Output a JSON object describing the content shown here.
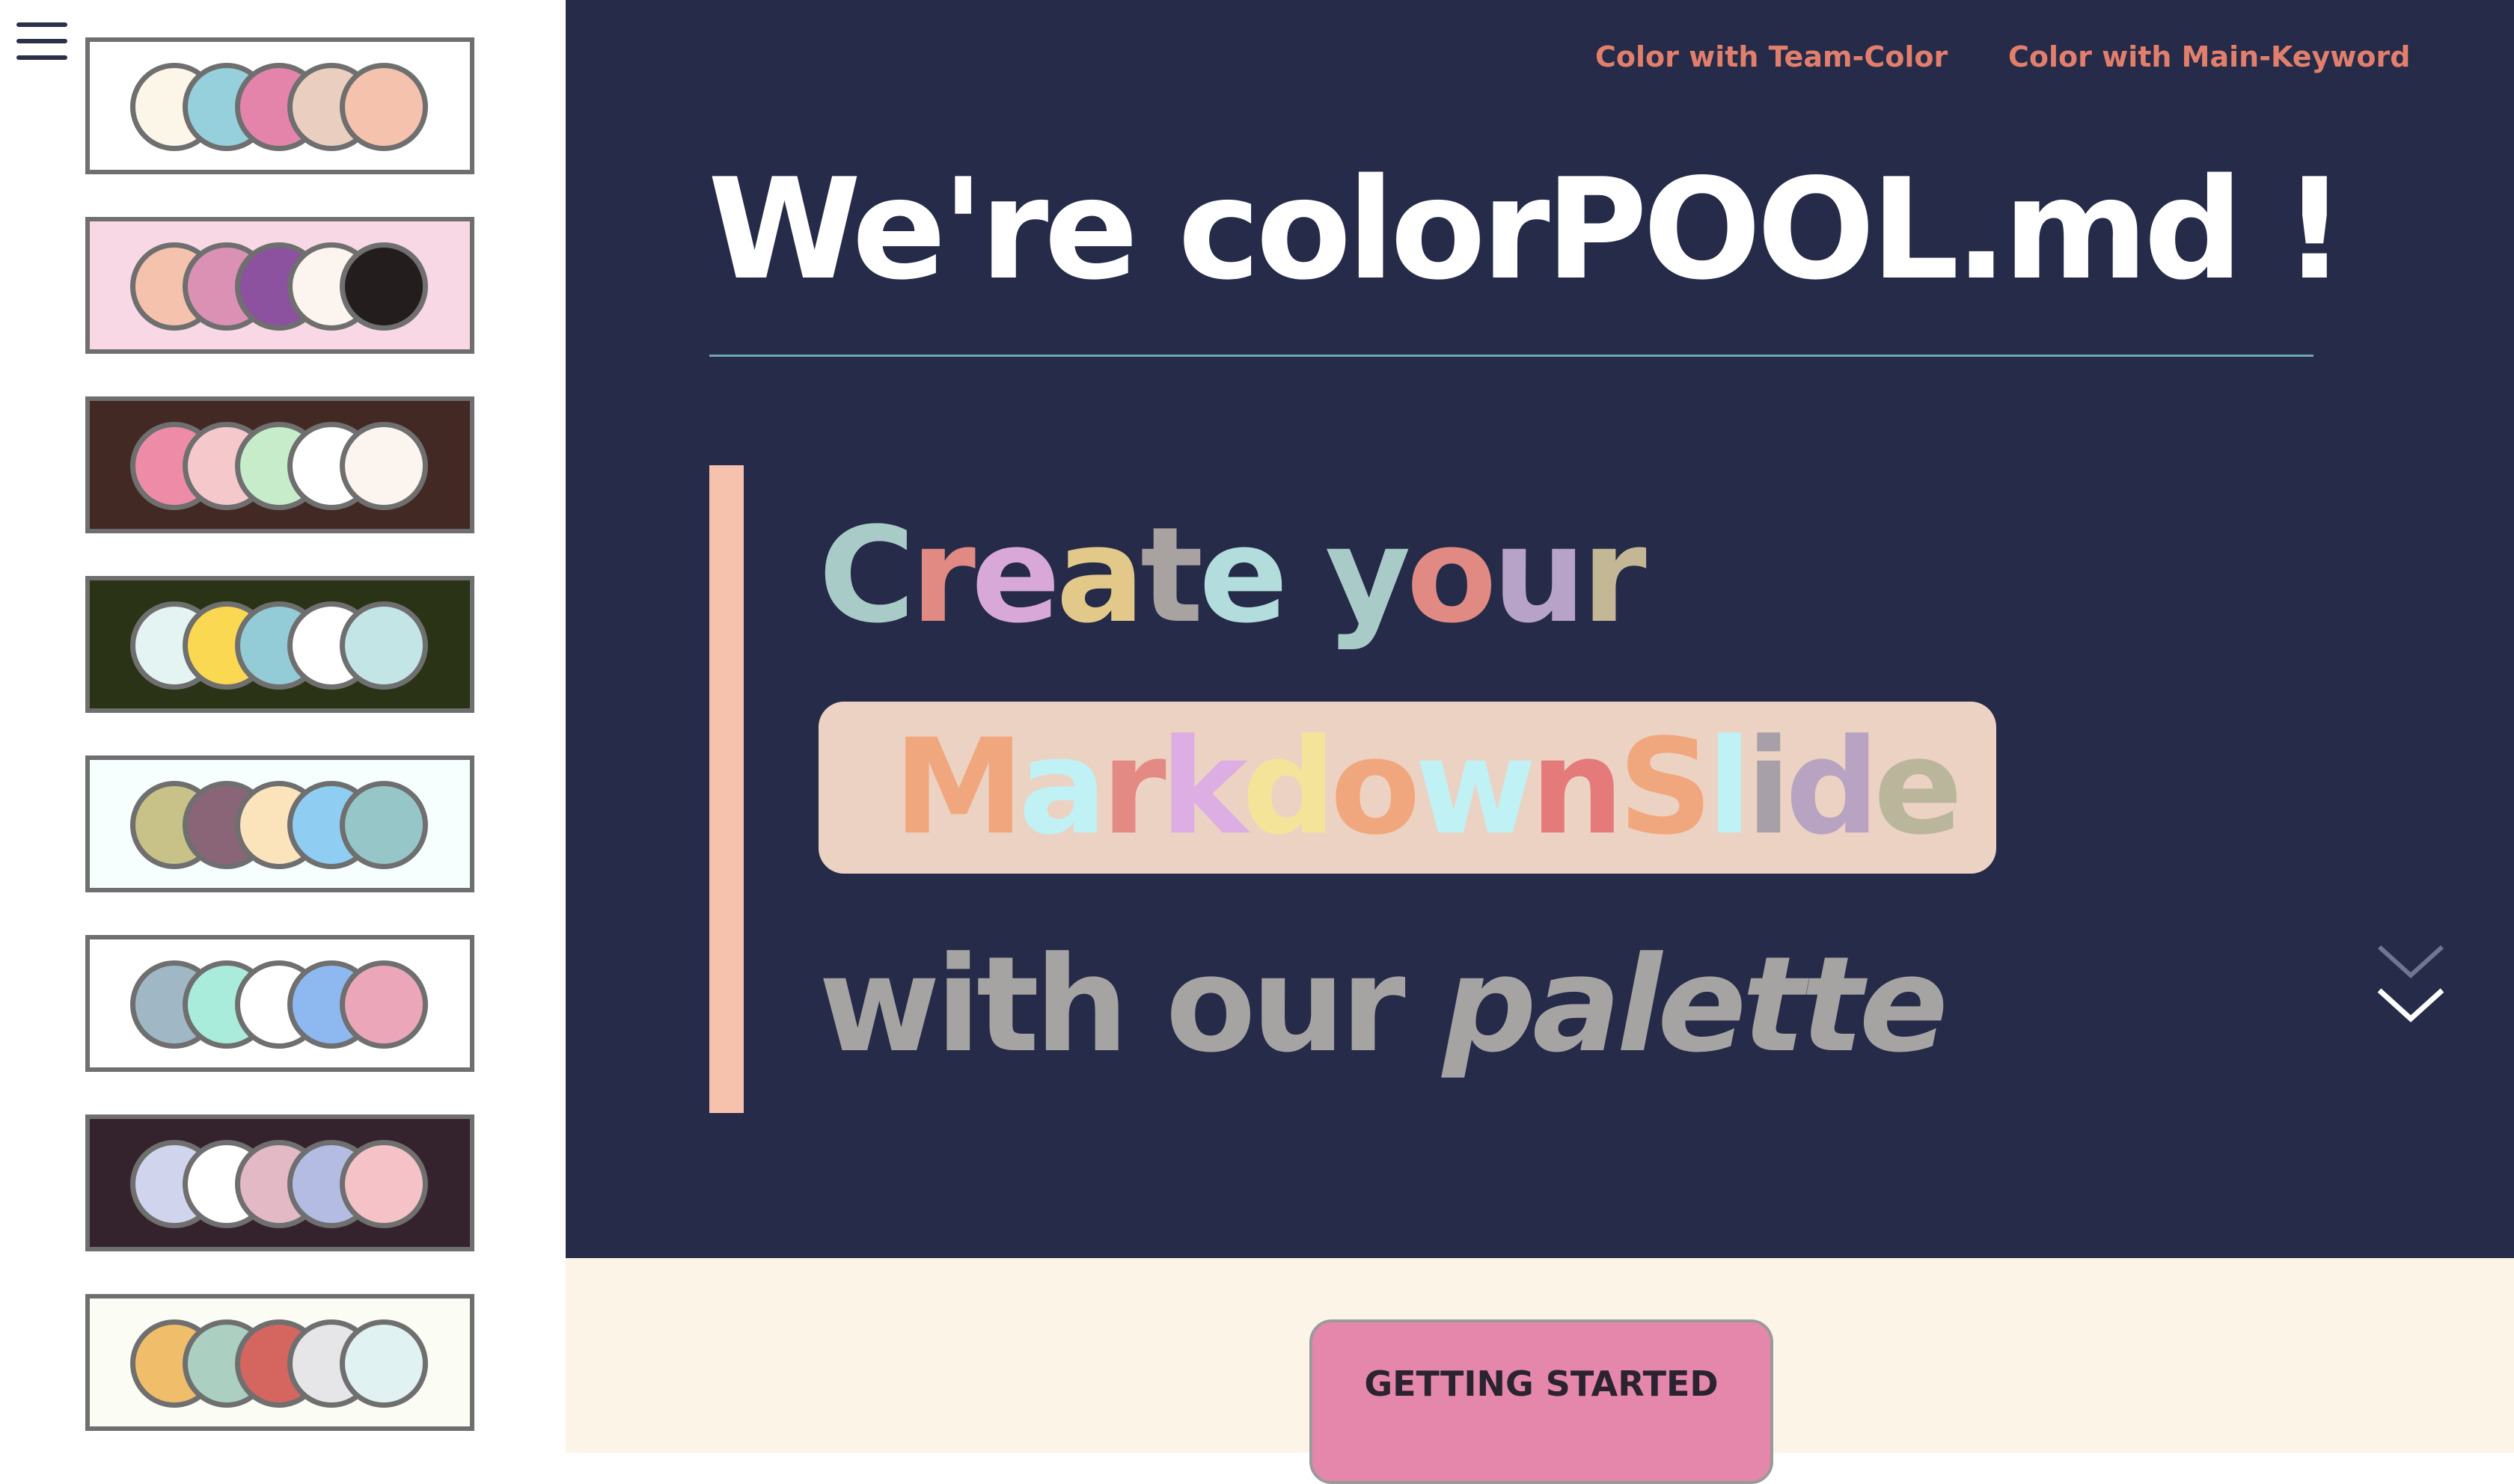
{
  "sidebar": {
    "menu_icon": "hamburger-menu-icon",
    "palettes": [
      {
        "background": "#ffffff",
        "swatches": [
          "#fcf6e8",
          "#95d0dc",
          "#e584ab",
          "#eacfc0",
          "#f5c2ad"
        ]
      },
      {
        "background": "#f7d8e4",
        "swatches": [
          "#f5c2ad",
          "#da91b3",
          "#8c519f",
          "#fcf4ee",
          "#231d1d"
        ]
      },
      {
        "background": "#422924",
        "swatches": [
          "#ee8ca8",
          "#f5c8cc",
          "#c6ecca",
          "#ffffff",
          "#fcf4ee"
        ]
      },
      {
        "background": "#2a3316",
        "swatches": [
          "#e4f4f3",
          "#fbd851",
          "#93cbd6",
          "#ffffff",
          "#c3e5e6"
        ]
      },
      {
        "background": "#f6fefe",
        "swatches": [
          "#c8c288",
          "#8a6578",
          "#fbe4bc",
          "#8fcdf2",
          "#97c6c9"
        ]
      },
      {
        "background": "#ffffff",
        "swatches": [
          "#a0b8c6",
          "#a9ecdc",
          "#ffffff",
          "#8db9f0",
          "#eba6b9"
        ]
      },
      {
        "background": "#34232c",
        "swatches": [
          "#d0d4ed",
          "#ffffff",
          "#e2b9c4",
          "#b5bce4",
          "#f5c2c8"
        ]
      },
      {
        "background": "#fbfdf4",
        "swatches": [
          "#f0bd6a",
          "#abcfc0",
          "#d4655f",
          "#e6e5e7",
          "#e0f2f2"
        ]
      }
    ]
  },
  "header": {
    "nav": [
      {
        "label": "Color with Team-Color"
      },
      {
        "label": "Color with Main-Keyword"
      }
    ]
  },
  "hero": {
    "title": "We're colorPOOL.md !",
    "line1": [
      {
        "t": "C",
        "c": "#a9cbc8"
      },
      {
        "t": "r",
        "c": "#e08a83"
      },
      {
        "t": "e",
        "c": "#d8a8d8"
      },
      {
        "t": "a",
        "c": "#e2c98a"
      },
      {
        "t": "t",
        "c": "#a8a2a0"
      },
      {
        "t": "e",
        "c": "#b3dcdc"
      },
      {
        "t": " ",
        "c": "#ffffff"
      },
      {
        "t": "y",
        "c": "#a9cbc8"
      },
      {
        "t": "o",
        "c": "#e08a83"
      },
      {
        "t": "u",
        "c": "#b8a3c8"
      },
      {
        "t": "r",
        "c": "#c4b795"
      }
    ],
    "line2": [
      {
        "t": "M",
        "c": "#f0a77e"
      },
      {
        "t": "a",
        "c": "#bff1f5"
      },
      {
        "t": "r",
        "c": "#e48a85"
      },
      {
        "t": "k",
        "c": "#dcaee3"
      },
      {
        "t": "d",
        "c": "#f4e49a"
      },
      {
        "t": "o",
        "c": "#f0a77e"
      },
      {
        "t": "w",
        "c": "#bff1f5"
      },
      {
        "t": "n",
        "c": "#e47a7a"
      },
      {
        "t": "S",
        "c": "#f0a77e"
      },
      {
        "t": "l",
        "c": "#bff1f5"
      },
      {
        "t": "i",
        "c": "#a8a0a8"
      },
      {
        "t": "d",
        "c": "#b9a3c3"
      },
      {
        "t": "e",
        "c": "#b9b69c"
      }
    ],
    "line3_plain": "with our ",
    "line3_italic": "palette",
    "scroll_icon": "chevron-down-icon"
  },
  "cta": {
    "label": "GETTING STARTED"
  }
}
